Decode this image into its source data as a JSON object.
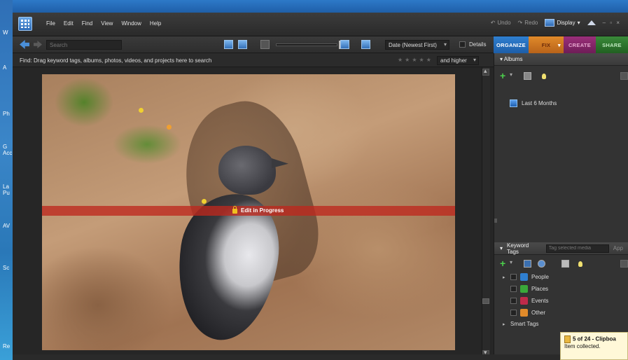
{
  "desktop": {
    "labels": [
      "W",
      "A",
      "Ph",
      "G\nAcc",
      "La\nPu",
      "AV",
      "Sc",
      "Re"
    ]
  },
  "menubar": {
    "items": [
      "File",
      "Edit",
      "Find",
      "View",
      "Window",
      "Help"
    ],
    "undo_label": "Undo",
    "redo_label": "Redo",
    "display_label": "Display",
    "window_controls": "– ▫ ×"
  },
  "toolbar": {
    "search_placeholder": "Search",
    "sort_value": "Date (Newest First)",
    "details_label": "Details"
  },
  "tabs": [
    {
      "label": "ORGANIZE",
      "color": "#2f7fd0"
    },
    {
      "label": "FIX",
      "color": "#e08a2a"
    },
    {
      "label": "CREATE",
      "color": "#9b2f7a"
    },
    {
      "label": "SHARE",
      "color": "#3a8a3a"
    }
  ],
  "findbar": {
    "text": "Find: Drag keyword tags, albums, photos, videos, and projects here to search",
    "rating_value": "and higher"
  },
  "media": {
    "edit_status": "Edit in Progress"
  },
  "albums": {
    "header": "Albums",
    "items": [
      {
        "label": "Last 6 Months",
        "icon": "album-icon"
      }
    ]
  },
  "keyword_tags": {
    "header": "Keyword Tags",
    "search_placeholder": "Tag selected media",
    "apply_label": "App",
    "items": [
      {
        "label": "People",
        "color": "#2f7fd0",
        "icon": "people-tag-icon",
        "expandable": true
      },
      {
        "label": "Places",
        "color": "#3aa83a",
        "icon": "places-tag-icon",
        "expandable": false
      },
      {
        "label": "Events",
        "color": "#c02a4a",
        "icon": "events-tag-icon",
        "expandable": false
      },
      {
        "label": "Other",
        "color": "#e08a2a",
        "icon": "other-tag-icon",
        "expandable": false
      }
    ],
    "smart_tags_label": "Smart Tags"
  },
  "notification": {
    "title": "5 of 24 - Clipboa",
    "body": "Item collected."
  }
}
